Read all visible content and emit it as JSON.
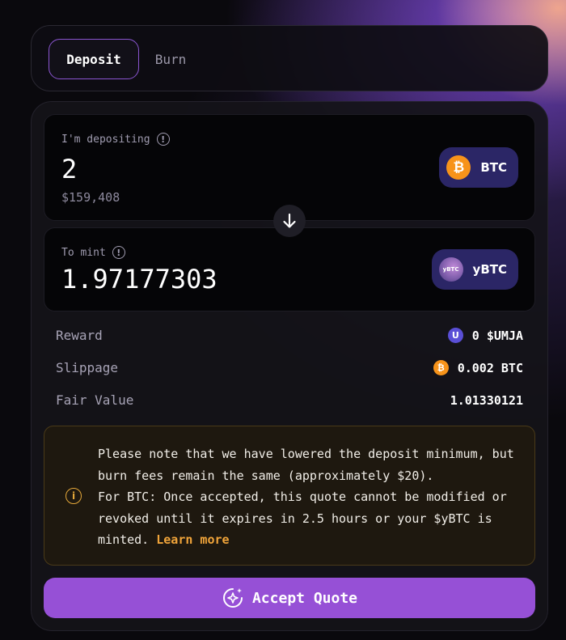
{
  "tabs": [
    {
      "label": "Deposit",
      "active": true
    },
    {
      "label": "Burn",
      "active": false
    }
  ],
  "deposit": {
    "label": "I'm depositing",
    "amount": "2",
    "usd_value": "$159,408",
    "token": "BTC"
  },
  "mint": {
    "label": "To mint",
    "amount": "1.97177303",
    "token": "yBTC",
    "token_icon_text": "yBTC"
  },
  "stats": [
    {
      "label": "Reward",
      "value": "0 $UMJA",
      "icon": "umja-token-icon"
    },
    {
      "label": "Slippage",
      "value": "0.002 BTC",
      "icon": "btc-icon"
    },
    {
      "label": "Fair Value",
      "value": "1.01330121",
      "icon": ""
    }
  ],
  "notice": {
    "line1": "Please note that we have lowered the deposit minimum, but burn fees remain the same (approximately $20).",
    "line2": "For BTC: Once accepted, this quote cannot be modified or revoked until it expires in 2.5 hours or your $yBTC is minted.",
    "link": "Learn more"
  },
  "accept_button": "Accept Quote",
  "colors": {
    "accent": "#9650d6",
    "btc": "#f7931a",
    "token_pill": "#2b2666",
    "notice_bg": "#1e180f",
    "link": "#f0a43a"
  }
}
